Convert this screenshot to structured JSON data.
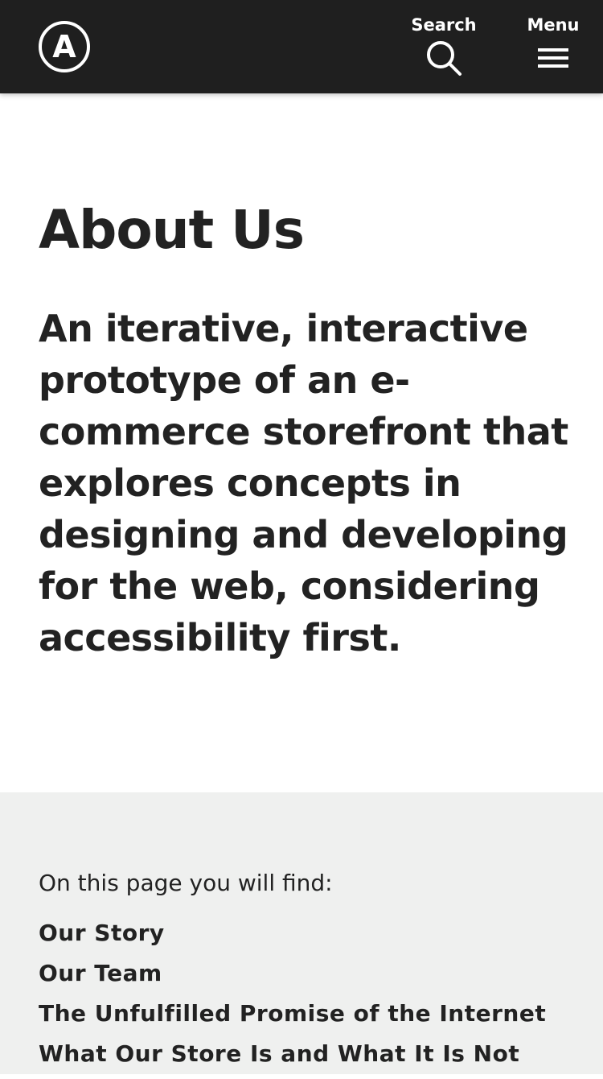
{
  "header": {
    "logo_letter": "A",
    "search_label": "Search",
    "menu_label": "Menu",
    "icons": {
      "logo": "circle-a-logo",
      "search": "search-icon",
      "menu": "hamburger-menu-icon"
    },
    "background_color": "#1f1f1f"
  },
  "main": {
    "title": "About Us",
    "intro": "An iterative, interactive prototype of an e-commerce storefront that explores concepts in designing and developing for the web, considering accessibility first."
  },
  "toc": {
    "heading": "On this page you will find:",
    "items": [
      "Our Story",
      "Our Team",
      "The Unfulfilled Promise of the Internet",
      "What Our Store Is and What It Is Not"
    ],
    "background_color": "#eff0ef"
  }
}
